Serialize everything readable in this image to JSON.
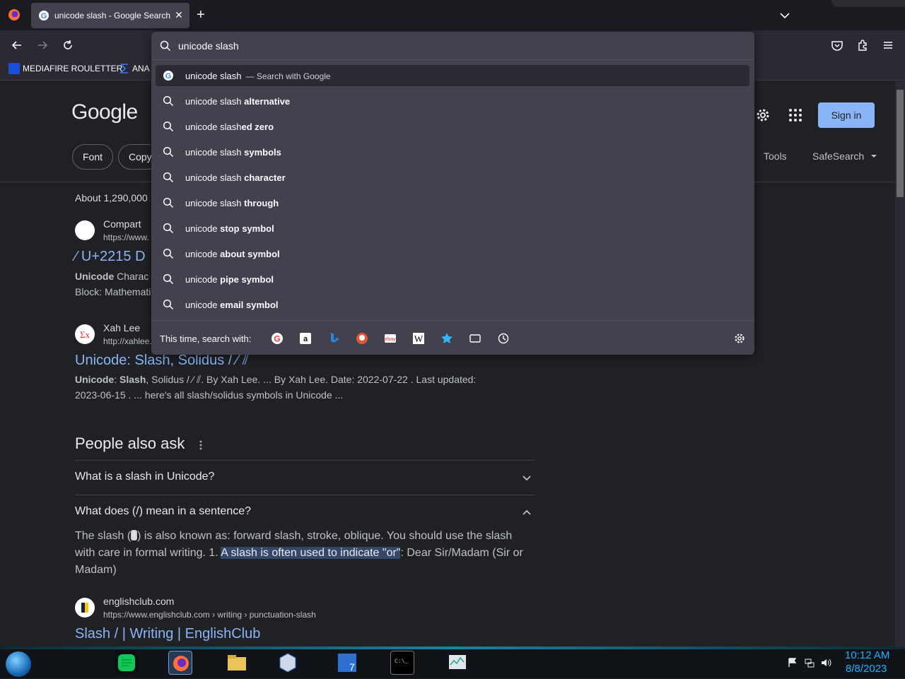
{
  "browser": {
    "tab_title": "unicode slash - Google Search",
    "tab_close": "✕",
    "new_tab": "+",
    "bookmarks": [
      "MEDIAFIRE ROULETTER",
      "ANA"
    ]
  },
  "urlbar": {
    "value": "unicode slash",
    "suggestions": [
      {
        "prefix": "unicode slash",
        "bold": "",
        "action": "— Search with Google"
      },
      {
        "prefix": "unicode slash ",
        "bold": "alternative",
        "action": ""
      },
      {
        "prefix": "unicode slash",
        "bold": "ed zero",
        "action": ""
      },
      {
        "prefix": "unicode slash ",
        "bold": "symbols",
        "action": ""
      },
      {
        "prefix": "unicode slash ",
        "bold": "character",
        "action": ""
      },
      {
        "prefix": "unicode slash ",
        "bold": "through",
        "action": ""
      },
      {
        "prefix": "unicode ",
        "bold": "stop symbol",
        "action": ""
      },
      {
        "prefix": "unicode ",
        "bold": "about symbol",
        "action": ""
      },
      {
        "prefix": "unicode ",
        "bold": "pipe symbol",
        "action": ""
      },
      {
        "prefix": "unicode ",
        "bold": "email symbol",
        "action": ""
      }
    ],
    "oneoff_label": "This time, search with:",
    "engines": [
      "google-icon",
      "amazon-icon",
      "bing-icon",
      "duckduckgo-icon",
      "ebay-icon",
      "wikipedia-icon",
      "bookmarks-icon",
      "tabs-icon",
      "history-icon"
    ]
  },
  "google": {
    "logo": "Google",
    "chips": [
      "Font",
      "Copy"
    ],
    "tools": "Tools",
    "safesearch": "SafeSearch",
    "sign_in": "Sign in",
    "stats": "About 1,290,000",
    "results": [
      {
        "site": "Compart",
        "url": "https://www.",
        "title": "∕ U+2215 D",
        "snippet_bold": "Unicode",
        "snippet_1": " Charac",
        "snippet_2": "Block: Mathemati"
      },
      {
        "site": "Xah Lee",
        "url": "http://xahlee.",
        "title": "Unicode: Slash, Solidus / ∕ ⫽",
        "snippet_bold": "Unicode",
        "snippet_mid": ": ",
        "snippet_bold2": "Slash",
        "snippet_1": ", Solidus / ∕ ⫽. By Xah Lee. ... By Xah Lee. Date: 2022-07-22 . Last updated:",
        "snippet_2": "2023-06-15 . ... here's all slash/solidus symbols in Unicode ..."
      }
    ],
    "paa": {
      "title": "People also ask",
      "q1": "What is a slash in Unicode?",
      "q2": "What does (/) mean in a sentence?",
      "ans_1": "The slash (",
      "ans_2": ") is also known as: forward slash, stroke, oblique. You should use the slash with care in formal writing. 1. ",
      "ans_hl": "A slash is often used to indicate \"or\"",
      "ans_3": ": Dear Sir/Madam (Sir or Madam)"
    },
    "result3": {
      "site": "englishclub.com",
      "url": "https://www.englishclub.com › writing › punctuation-slash",
      "title": "Slash / | Writing | EnglishClub"
    }
  },
  "taskbar": {
    "time": "10:12 AM",
    "date": "8/8/2023"
  },
  "colors": {
    "accent": "#8ab4f8",
    "clock": "#19b4ff"
  }
}
